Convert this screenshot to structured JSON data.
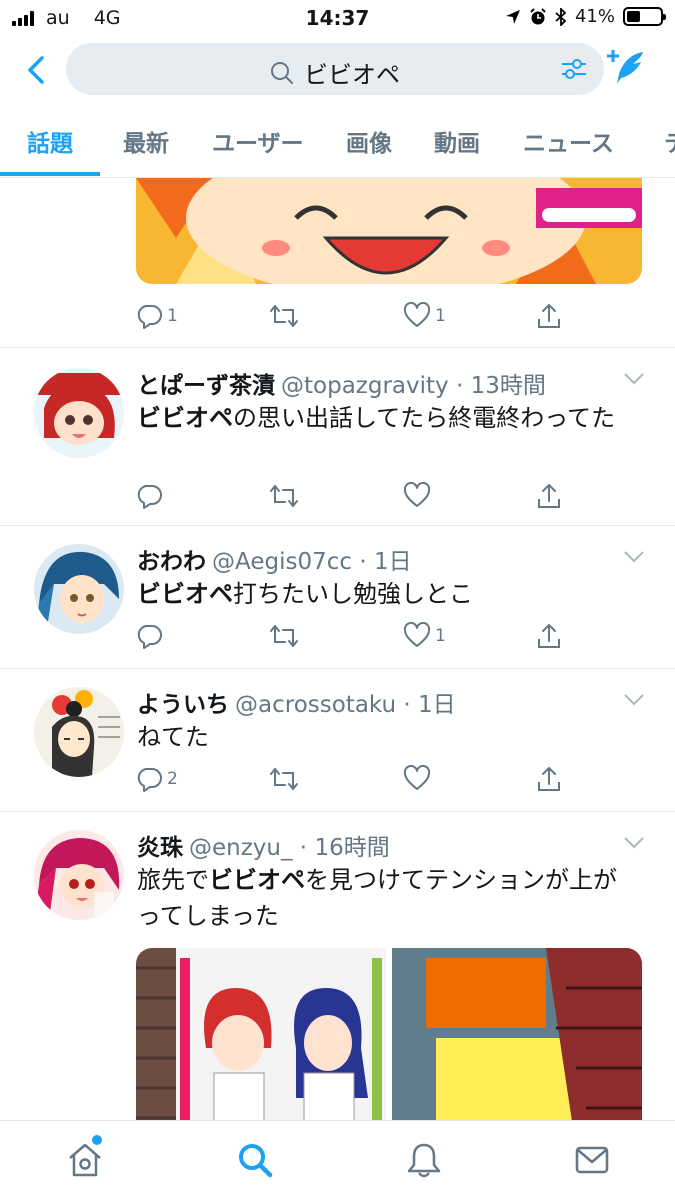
{
  "status": {
    "carrier": "au",
    "network": "4G",
    "time": "14:37",
    "battery": "41%",
    "battery_level": 0.41
  },
  "search": {
    "query": "ビビオペ"
  },
  "tabs": [
    {
      "label": "話題"
    },
    {
      "label": "最新"
    },
    {
      "label": "ユーザー"
    },
    {
      "label": "画像"
    },
    {
      "label": "動画"
    },
    {
      "label": "ニュース"
    },
    {
      "label": "テ"
    }
  ],
  "tweets": [
    {
      "reply": "1",
      "retweet": "",
      "like": "1"
    },
    {
      "name": "とぱーず茶漬",
      "handle": "@topazgravity",
      "time": "13時間",
      "text_pre": "",
      "text_bold": "ビビオペ",
      "text_post": "の思い出話してたら終電終わってた",
      "reply": "",
      "retweet": "",
      "like": ""
    },
    {
      "name": "おわわ",
      "handle": "@Aegis07cc",
      "time": "1日",
      "text_pre": "",
      "text_bold": "ビビオペ",
      "text_post": "打ちたいし勉強しとこ",
      "reply": "",
      "retweet": "",
      "like": "1"
    },
    {
      "name": "よういち",
      "handle": "@acrossotaku",
      "time": "1日",
      "text_pre": "ねてた",
      "text_bold": "",
      "text_post": "",
      "reply": "2",
      "retweet": "",
      "like": ""
    },
    {
      "name": "炎珠",
      "handle": "@enzyu_",
      "time": "16時間",
      "text_pre": "旅先で",
      "text_bold": "ビビオペ",
      "text_post": "を見つけてテンションが上がってしまった"
    }
  ],
  "colors": {
    "accent": "#1da1f2",
    "muted": "#657786",
    "search_bg": "#e6ecf0",
    "border": "#e1e8ed"
  }
}
